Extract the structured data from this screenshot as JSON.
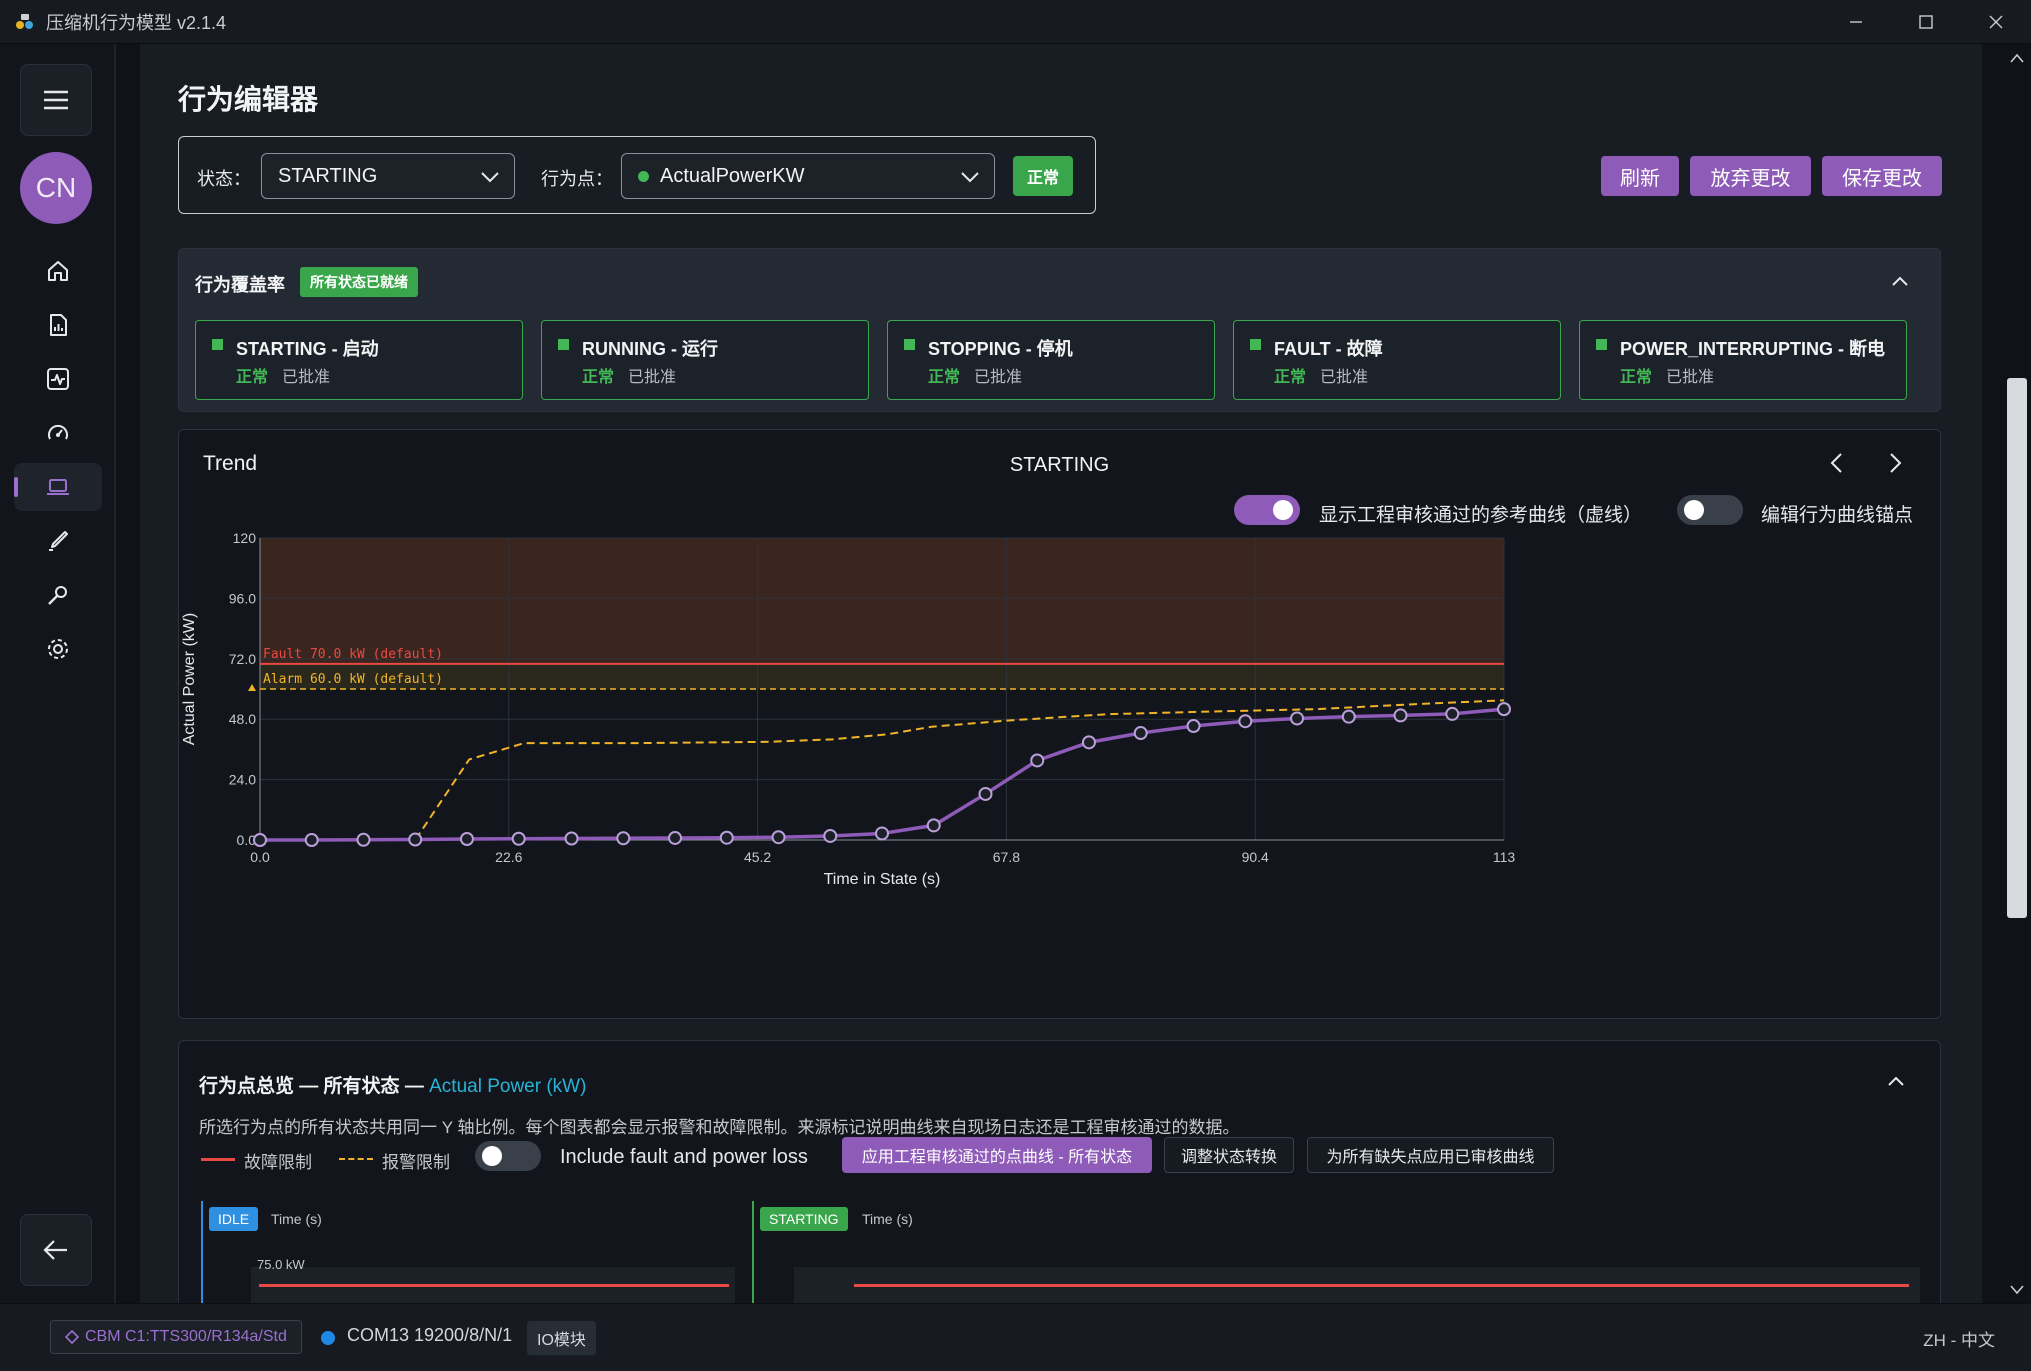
{
  "window": {
    "title": "压缩机行为模型 v2.1.4"
  },
  "rail": {
    "avatar_initials": "CN"
  },
  "page": {
    "title": "行为编辑器"
  },
  "selectors": {
    "state_label": "状态：",
    "state_value": "STARTING",
    "point_label": "行为点：",
    "point_value": "ActualPowerKW",
    "point_status": "正常"
  },
  "actions": {
    "refresh": "刷新",
    "discard": "放弃更改",
    "save": "保存更改"
  },
  "coverage": {
    "title": "行为覆盖率",
    "badge": "所有状态已就绪",
    "states": [
      {
        "name": "STARTING - 启动",
        "status": "正常",
        "approval": "已批准"
      },
      {
        "name": "RUNNING - 运行",
        "status": "正常",
        "approval": "已批准"
      },
      {
        "name": "STOPPING - 停机",
        "status": "正常",
        "approval": "已批准"
      },
      {
        "name": "FAULT - 故障",
        "status": "正常",
        "approval": "已批准"
      },
      {
        "name": "POWER_INTERRUPTING - 断电",
        "status": "正常",
        "approval": "已批准"
      }
    ]
  },
  "trend": {
    "title": "Trend",
    "state": "STARTING",
    "toggle_reference_label": "显示工程审核通过的参考曲线（虚线）",
    "toggle_reference_on": true,
    "toggle_edit_label": "编辑行为曲线锚点",
    "toggle_edit_on": false
  },
  "chart_data": {
    "type": "line",
    "xlabel": "Time in State (s)",
    "ylabel": "Actual Power (kW)",
    "xlim": [
      0,
      113
    ],
    "ylim": [
      0,
      120
    ],
    "x_ticks": [
      "0.0",
      "22.6",
      "45.2",
      "67.8",
      "90.4",
      "113"
    ],
    "y_ticks": [
      "0.0",
      "24.0",
      "48.0",
      "72.0",
      "96.0",
      "120"
    ],
    "limits": [
      {
        "name": "Fault",
        "value": 70,
        "label": "Fault  70.0 kW  (default)",
        "color": "#e84a43"
      },
      {
        "name": "Alarm",
        "value": 60,
        "label": "Alarm  60.0 kW  (default)",
        "color": "#f0b429"
      }
    ],
    "series": [
      {
        "style": "solid-markers",
        "color": "#8e5bb8",
        "x": [
          0,
          4.7,
          9.4,
          14.1,
          18.8,
          23.5,
          28.3,
          33.0,
          37.7,
          42.4,
          47.1,
          51.8,
          56.5,
          61.2,
          65.9,
          70.6,
          75.3,
          80.0,
          84.8,
          89.5,
          94.2,
          98.9,
          103.6,
          108.3,
          113
        ],
        "y": [
          0,
          0,
          0.1,
          0.2,
          0.4,
          0.5,
          0.6,
          0.7,
          0.8,
          0.9,
          1.1,
          1.6,
          2.6,
          5.8,
          18.3,
          31.6,
          38.8,
          42.5,
          45.3,
          47.2,
          48.3,
          49.0,
          49.5,
          50.1,
          52.0
        ]
      },
      {
        "style": "dashed",
        "color": "#f0b429",
        "x": [
          0,
          14.1,
          19,
          24,
          34,
          46,
          52,
          57,
          61,
          68,
          77,
          86,
          96,
          105,
          113
        ],
        "y": [
          0,
          0,
          32,
          38.5,
          38.5,
          39,
          40,
          42,
          45,
          47.5,
          50,
          51,
          52,
          54,
          55.5
        ]
      }
    ]
  },
  "overview": {
    "title_prefix": "行为点总览 — 所有状态 —",
    "title_accent": "Actual Power (kW)",
    "description": "所选行为点的所有状态共用同一 Y 轴比例。每个图表都会显示报警和故障限制。来源标记说明曲线来自现场日志还是工程审核通过的数据。",
    "legend_fault": "故障限制",
    "legend_alarm": "报警限制",
    "toggle_label": "Include fault and power loss",
    "btn_apply_all": "应用工程审核通过的点曲线 - 所有状态",
    "btn_adjust": "调整状态转换",
    "btn_fill_missing": "为所有缺失点应用已审核曲线",
    "mini_charts": [
      {
        "state": "IDLE",
        "xlabel": "Time (s)",
        "ytick": "75.0 kW",
        "color": "#2f8fe0"
      },
      {
        "state": "STARTING",
        "xlabel": "Time (s)",
        "color": "#3aa64b"
      }
    ]
  },
  "statusbar": {
    "device": "CBM C1:TTS300/R134a/Std",
    "port": "COM13 19200/8/N/1",
    "module": "IO模块",
    "language": "ZH - 中文"
  }
}
